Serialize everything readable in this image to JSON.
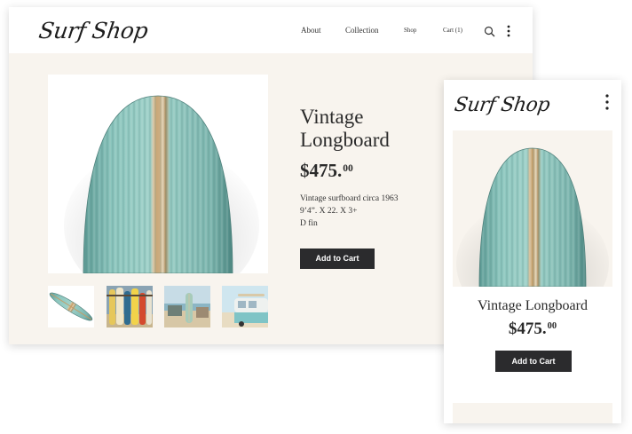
{
  "desktop": {
    "logo": "Surf Shop",
    "nav": {
      "about": "About",
      "collection": "Collection",
      "shop": "Shop",
      "cart": "Cart (1)"
    },
    "product": {
      "title_line1": "Vintage",
      "title_line2": "Longboard",
      "price_main": "$475.",
      "price_cents": "00",
      "description": [
        "Vintage surfboard circa 1963",
        "9’4”. X 22. X 3+",
        "D fin"
      ],
      "add_to_cart": "Add to Cart"
    },
    "thumbnails": [
      "board-angled",
      "boards-on-rack",
      "board-on-beach",
      "van-with-board"
    ]
  },
  "mobile": {
    "logo": "Surf Shop",
    "product": {
      "title": "Vintage Longboard",
      "price_main": "$475.",
      "price_cents": "00",
      "add_to_cart": "Add to Cart"
    }
  },
  "icons": [
    "search-icon",
    "more-vertical-icon"
  ],
  "colors": {
    "main_bg": "#f8f4ee",
    "button_bg": "#2b2b2d",
    "board_teal": "#7fb8b2",
    "board_wood": "#c9a77a"
  }
}
